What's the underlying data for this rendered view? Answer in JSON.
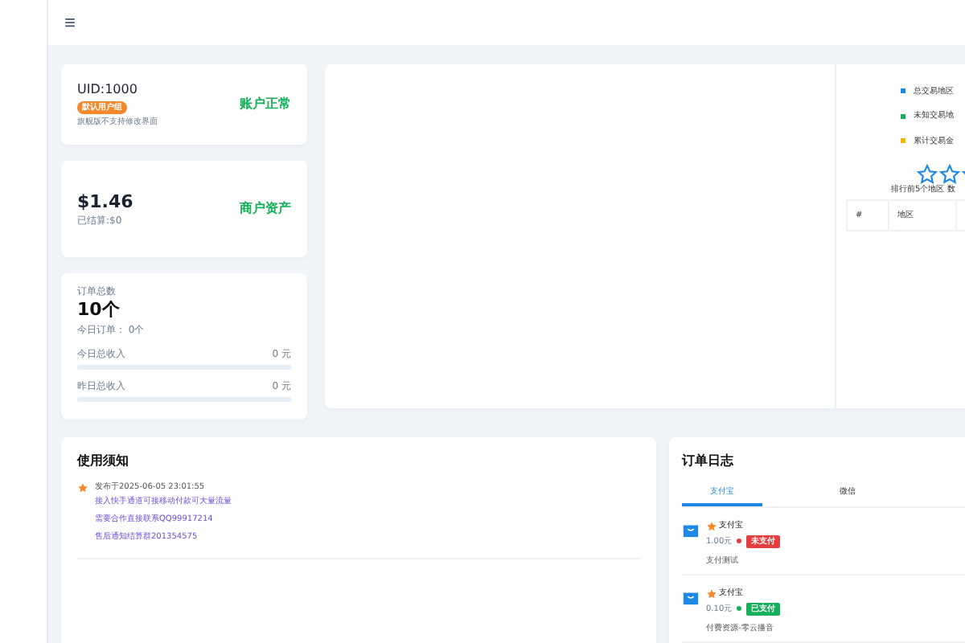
{
  "header": {
    "menu_icon": "≡"
  },
  "account": {
    "uid": "UID:1000",
    "group": "默认用户组",
    "note": "旗舰版不支持修改界面",
    "status": "账户正常"
  },
  "balance": {
    "amount": "$1.46",
    "settled": "已结算:$0",
    "label": "商户资产"
  },
  "orders_summary": {
    "label": "订单总数",
    "count": "10个",
    "today_orders": "今日订单： 0个",
    "rows": [
      {
        "label": "今日总收入",
        "value": "0 元",
        "level": 0
      },
      {
        "label": "昨日总收入",
        "value": "0 元",
        "level": 0
      }
    ]
  },
  "region_panel": {
    "legend": [
      {
        "label": "总交易地区",
        "color": "#1e88e5"
      },
      {
        "label": "未知交易地",
        "color": "#16b05a"
      },
      {
        "label": "累计交易金",
        "color": "#f5b800"
      }
    ],
    "caption": [
      "排行前5个地区",
      "数"
    ],
    "table": {
      "columns": [
        "#",
        "地区"
      ]
    }
  },
  "notice": {
    "title": "使用须知",
    "date": "发布于2025-06-05 23:01:55",
    "lines": [
      "接入快手通道可接移动付款可大量流量",
      "需要合作直接联系QQ99917214",
      "售后通知结算群201354575"
    ]
  },
  "order_log": {
    "title": "订单日志",
    "tabs": [
      {
        "label": "支付宝",
        "selected": true
      },
      {
        "label": "微信",
        "selected": false
      }
    ],
    "entries": [
      {
        "name": "支付宝",
        "amount": "1.00元",
        "status": "未支付",
        "paid": false,
        "desc": "支付测试"
      },
      {
        "name": "支付宝",
        "amount": "0.10元",
        "status": "已支付",
        "paid": true,
        "desc": "付费资源-零云播音"
      }
    ]
  }
}
